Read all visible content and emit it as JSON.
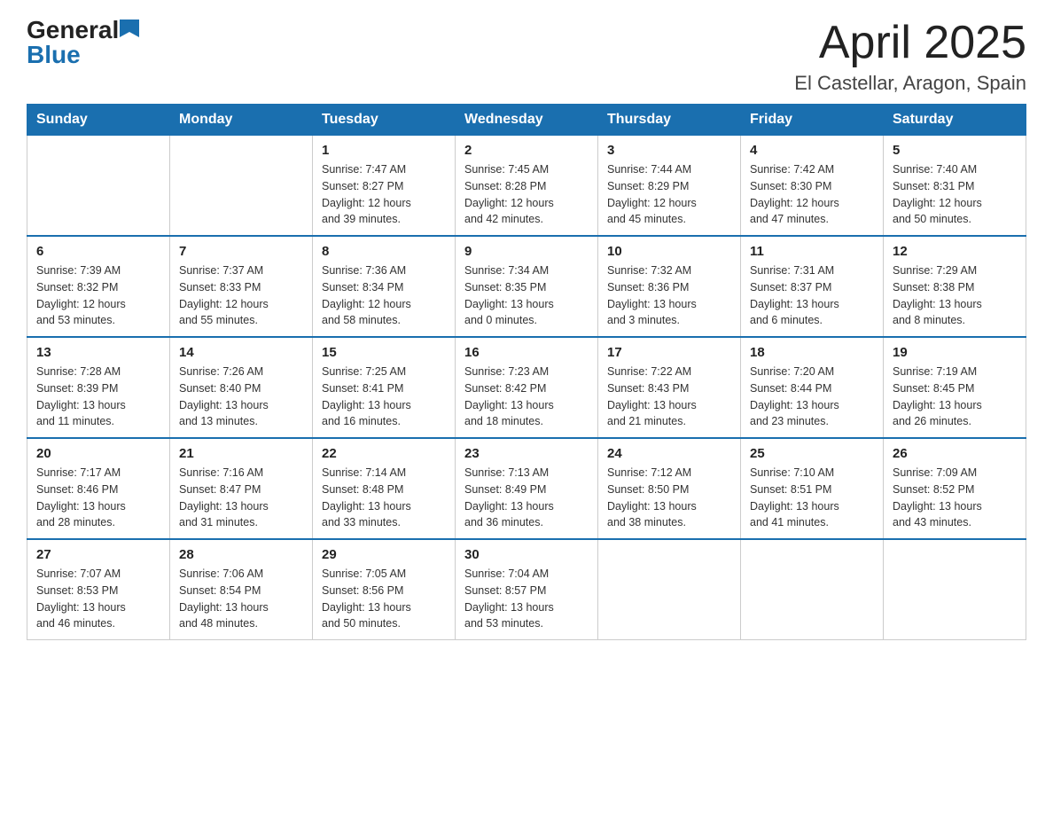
{
  "logo": {
    "general": "General",
    "blue": "Blue"
  },
  "title": "April 2025",
  "subtitle": "El Castellar, Aragon, Spain",
  "weekdays": [
    "Sunday",
    "Monday",
    "Tuesday",
    "Wednesday",
    "Thursday",
    "Friday",
    "Saturday"
  ],
  "weeks": [
    [
      {
        "day": "",
        "info": ""
      },
      {
        "day": "",
        "info": ""
      },
      {
        "day": "1",
        "info": "Sunrise: 7:47 AM\nSunset: 8:27 PM\nDaylight: 12 hours\nand 39 minutes."
      },
      {
        "day": "2",
        "info": "Sunrise: 7:45 AM\nSunset: 8:28 PM\nDaylight: 12 hours\nand 42 minutes."
      },
      {
        "day": "3",
        "info": "Sunrise: 7:44 AM\nSunset: 8:29 PM\nDaylight: 12 hours\nand 45 minutes."
      },
      {
        "day": "4",
        "info": "Sunrise: 7:42 AM\nSunset: 8:30 PM\nDaylight: 12 hours\nand 47 minutes."
      },
      {
        "day": "5",
        "info": "Sunrise: 7:40 AM\nSunset: 8:31 PM\nDaylight: 12 hours\nand 50 minutes."
      }
    ],
    [
      {
        "day": "6",
        "info": "Sunrise: 7:39 AM\nSunset: 8:32 PM\nDaylight: 12 hours\nand 53 minutes."
      },
      {
        "day": "7",
        "info": "Sunrise: 7:37 AM\nSunset: 8:33 PM\nDaylight: 12 hours\nand 55 minutes."
      },
      {
        "day": "8",
        "info": "Sunrise: 7:36 AM\nSunset: 8:34 PM\nDaylight: 12 hours\nand 58 minutes."
      },
      {
        "day": "9",
        "info": "Sunrise: 7:34 AM\nSunset: 8:35 PM\nDaylight: 13 hours\nand 0 minutes."
      },
      {
        "day": "10",
        "info": "Sunrise: 7:32 AM\nSunset: 8:36 PM\nDaylight: 13 hours\nand 3 minutes."
      },
      {
        "day": "11",
        "info": "Sunrise: 7:31 AM\nSunset: 8:37 PM\nDaylight: 13 hours\nand 6 minutes."
      },
      {
        "day": "12",
        "info": "Sunrise: 7:29 AM\nSunset: 8:38 PM\nDaylight: 13 hours\nand 8 minutes."
      }
    ],
    [
      {
        "day": "13",
        "info": "Sunrise: 7:28 AM\nSunset: 8:39 PM\nDaylight: 13 hours\nand 11 minutes."
      },
      {
        "day": "14",
        "info": "Sunrise: 7:26 AM\nSunset: 8:40 PM\nDaylight: 13 hours\nand 13 minutes."
      },
      {
        "day": "15",
        "info": "Sunrise: 7:25 AM\nSunset: 8:41 PM\nDaylight: 13 hours\nand 16 minutes."
      },
      {
        "day": "16",
        "info": "Sunrise: 7:23 AM\nSunset: 8:42 PM\nDaylight: 13 hours\nand 18 minutes."
      },
      {
        "day": "17",
        "info": "Sunrise: 7:22 AM\nSunset: 8:43 PM\nDaylight: 13 hours\nand 21 minutes."
      },
      {
        "day": "18",
        "info": "Sunrise: 7:20 AM\nSunset: 8:44 PM\nDaylight: 13 hours\nand 23 minutes."
      },
      {
        "day": "19",
        "info": "Sunrise: 7:19 AM\nSunset: 8:45 PM\nDaylight: 13 hours\nand 26 minutes."
      }
    ],
    [
      {
        "day": "20",
        "info": "Sunrise: 7:17 AM\nSunset: 8:46 PM\nDaylight: 13 hours\nand 28 minutes."
      },
      {
        "day": "21",
        "info": "Sunrise: 7:16 AM\nSunset: 8:47 PM\nDaylight: 13 hours\nand 31 minutes."
      },
      {
        "day": "22",
        "info": "Sunrise: 7:14 AM\nSunset: 8:48 PM\nDaylight: 13 hours\nand 33 minutes."
      },
      {
        "day": "23",
        "info": "Sunrise: 7:13 AM\nSunset: 8:49 PM\nDaylight: 13 hours\nand 36 minutes."
      },
      {
        "day": "24",
        "info": "Sunrise: 7:12 AM\nSunset: 8:50 PM\nDaylight: 13 hours\nand 38 minutes."
      },
      {
        "day": "25",
        "info": "Sunrise: 7:10 AM\nSunset: 8:51 PM\nDaylight: 13 hours\nand 41 minutes."
      },
      {
        "day": "26",
        "info": "Sunrise: 7:09 AM\nSunset: 8:52 PM\nDaylight: 13 hours\nand 43 minutes."
      }
    ],
    [
      {
        "day": "27",
        "info": "Sunrise: 7:07 AM\nSunset: 8:53 PM\nDaylight: 13 hours\nand 46 minutes."
      },
      {
        "day": "28",
        "info": "Sunrise: 7:06 AM\nSunset: 8:54 PM\nDaylight: 13 hours\nand 48 minutes."
      },
      {
        "day": "29",
        "info": "Sunrise: 7:05 AM\nSunset: 8:56 PM\nDaylight: 13 hours\nand 50 minutes."
      },
      {
        "day": "30",
        "info": "Sunrise: 7:04 AM\nSunset: 8:57 PM\nDaylight: 13 hours\nand 53 minutes."
      },
      {
        "day": "",
        "info": ""
      },
      {
        "day": "",
        "info": ""
      },
      {
        "day": "",
        "info": ""
      }
    ]
  ],
  "colors": {
    "header_bg": "#1a6faf",
    "header_text": "#ffffff",
    "border": "#cccccc",
    "row_separator": "#1a6faf"
  }
}
